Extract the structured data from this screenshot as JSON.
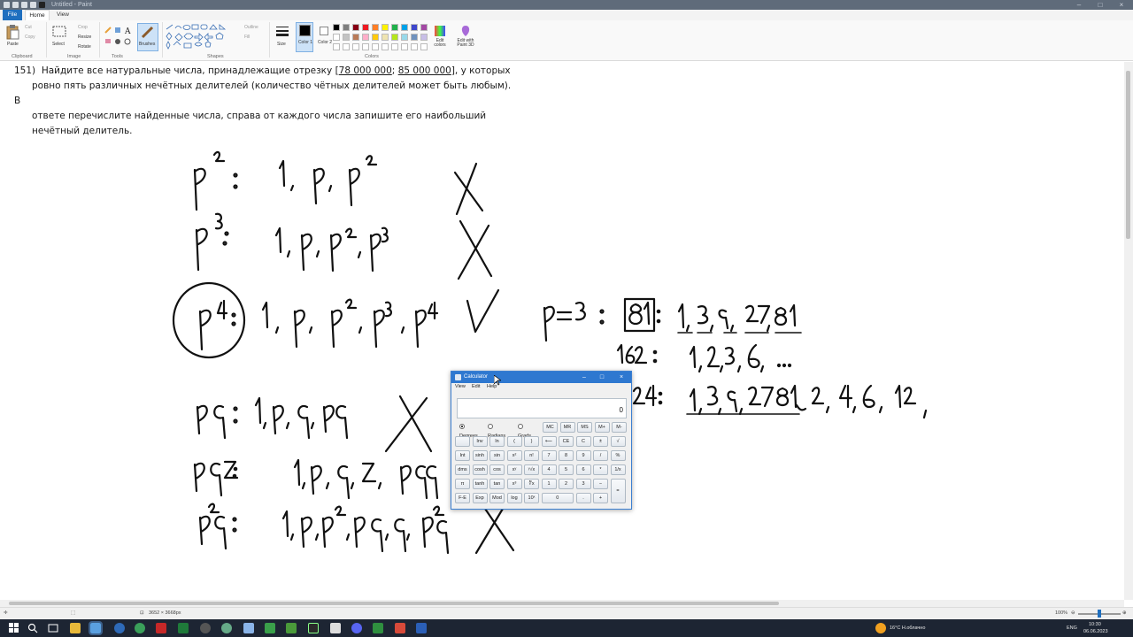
{
  "window": {
    "title": "Untitled - Paint"
  },
  "ribbon": {
    "tabs": [
      "File",
      "Home",
      "View"
    ],
    "clipboard": {
      "paste": "Paste",
      "cut": "Cut",
      "copy": "Copy",
      "group": "Clipboard"
    },
    "image": {
      "select": "Select",
      "crop": "Crop",
      "resize": "Resize",
      "rotate": "Rotate",
      "group": "Image"
    },
    "tools": {
      "group": "Tools",
      "brushes": "Brushes"
    },
    "shapes": {
      "outline": "Outline",
      "fill": "Fill",
      "group": "Shapes"
    },
    "size": "Size",
    "color1": "Color 1",
    "color2": "Color 2",
    "colors_group": "Colors",
    "edit_colors": "Edit colors",
    "edit_paint3d": "Edit with Paint 3D",
    "palette": [
      "#000000",
      "#7f7f7f",
      "#880015",
      "#ed1c24",
      "#ff7f27",
      "#fff200",
      "#22b14c",
      "#00a2e8",
      "#3f48cc",
      "#a349a4",
      "#ffffff",
      "#c3c3c3",
      "#b97a57",
      "#ffaec9",
      "#ffc90e",
      "#efe4b0",
      "#b5e61d",
      "#99d9ea",
      "#7092be",
      "#c8bfe7"
    ]
  },
  "problem": {
    "num": "151)",
    "text_before": "Найдите все натуральные числа, принадлежащие отрезку [",
    "range_a": "78 000 000",
    "sep": "; ",
    "range_b": "85 000 000",
    "text_after": "], у которых",
    "line2": "ровно пять различных нечётных делителей (количество чётных делителей может быть любым). В",
    "line3": "ответе перечислите найденные числа, справа от каждого числа запишите его наибольший",
    "line4": "нечётный делитель."
  },
  "calculator": {
    "title": "Calculator",
    "menu": [
      "View",
      "Edit",
      "Help"
    ],
    "display": "0",
    "angle_modes": [
      "Degrees",
      "Radians",
      "Grads"
    ],
    "keys": [
      [
        "",
        "Inv",
        "ln",
        "(",
        ")",
        "⟵",
        "CE",
        "C",
        "±",
        "√"
      ],
      [
        "Int",
        "sinh",
        "sin",
        "x²",
        "n!",
        "7",
        "8",
        "9",
        "/",
        "%"
      ],
      [
        "dms",
        "cosh",
        "cos",
        "xʸ",
        "ʸ√x",
        "4",
        "5",
        "6",
        "*",
        "1/x"
      ],
      [
        "π",
        "tanh",
        "tan",
        "x³",
        "∛x",
        "1",
        "2",
        "3",
        "−",
        "="
      ],
      [
        "F-E",
        "Exp",
        "Mod",
        "log",
        "10ˣ",
        "0",
        "",
        ".",
        "+",
        ""
      ]
    ],
    "memory": [
      "MC",
      "MR",
      "MS",
      "M+",
      "M-"
    ]
  },
  "status": {
    "size": "3652 × 3668px",
    "zoom": "100%"
  },
  "taskbar": {
    "weather": "16°C  Н.облачно",
    "lang": "ENG",
    "time": "10:30",
    "date": "06.06.2023"
  }
}
